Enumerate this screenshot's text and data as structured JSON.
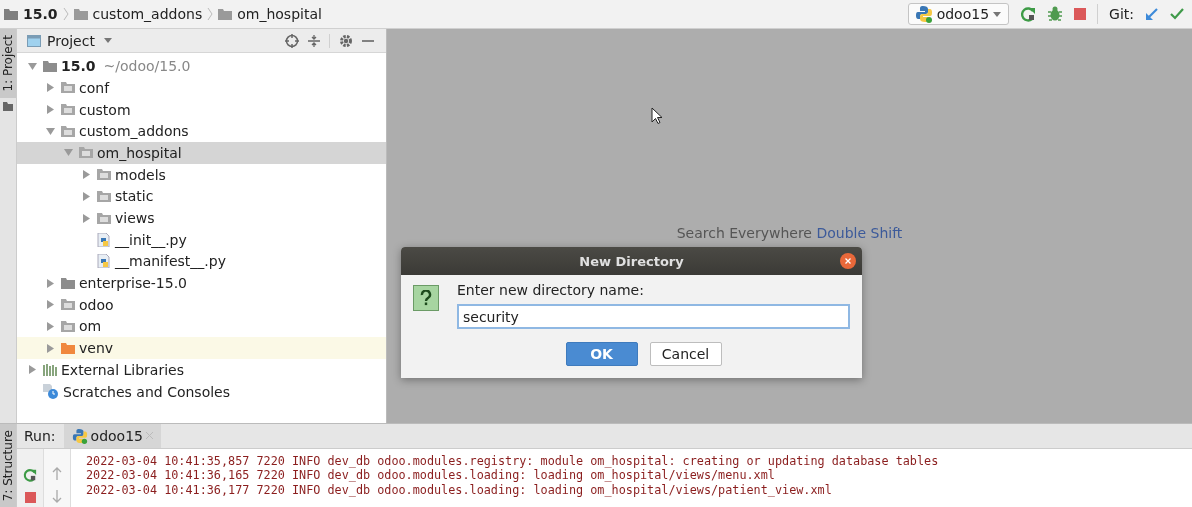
{
  "breadcrumb": [
    {
      "label": "15.0",
      "bold": true
    },
    {
      "label": "custom_addons",
      "bold": false
    },
    {
      "label": "om_hospital",
      "bold": false
    }
  ],
  "toolbar": {
    "run_config": "odoo15",
    "vcs_label": "Git:"
  },
  "left_strip": {
    "tab": "1: Project"
  },
  "project_panel": {
    "title": "Project",
    "tree": [
      {
        "label": "15.0",
        "hint": "~/odoo/15.0",
        "kind": "root-folder",
        "expanded": true,
        "selected": false,
        "children": [
          {
            "label": "conf",
            "kind": "folder",
            "expanded": false,
            "selected": false
          },
          {
            "label": "custom",
            "kind": "folder",
            "expanded": false,
            "selected": false
          },
          {
            "label": "custom_addons",
            "kind": "folder",
            "expanded": true,
            "selected": false,
            "children": [
              {
                "label": "om_hospital",
                "kind": "folder",
                "expanded": true,
                "selected": true,
                "children": [
                  {
                    "label": "models",
                    "kind": "folder",
                    "expanded": false,
                    "selected": false
                  },
                  {
                    "label": "static",
                    "kind": "folder",
                    "expanded": false,
                    "selected": false
                  },
                  {
                    "label": "views",
                    "kind": "folder",
                    "expanded": false,
                    "selected": false
                  },
                  {
                    "label": "__init__.py",
                    "kind": "python-file",
                    "selected": false
                  },
                  {
                    "label": "__manifest__.py",
                    "kind": "python-file",
                    "selected": false
                  }
                ]
              }
            ]
          },
          {
            "label": "enterprise-15.0",
            "kind": "root-folder",
            "expanded": false,
            "selected": false
          },
          {
            "label": "odoo",
            "kind": "folder",
            "expanded": false,
            "selected": false
          },
          {
            "label": "om",
            "kind": "folder",
            "expanded": false,
            "selected": false
          },
          {
            "label": "venv",
            "kind": "excluded-folder",
            "expanded": false,
            "selected": false
          }
        ]
      },
      {
        "label": "External Libraries",
        "kind": "libraries",
        "expanded": false,
        "selected": false
      },
      {
        "label": "Scratches and Consoles",
        "kind": "scratches",
        "selected": false
      }
    ]
  },
  "editor_hint": {
    "text": "Search Everywhere",
    "shortcut": "Double Shift"
  },
  "dialog": {
    "title": "New Directory",
    "prompt": "Enter new directory name:",
    "value": "security",
    "buttons": [
      {
        "label": "OK",
        "default": true
      },
      {
        "label": "Cancel",
        "default": false
      }
    ]
  },
  "run_panel": {
    "label": "Run:",
    "tab": "odoo15",
    "side_tab": "7: Structure",
    "log": [
      "2022-03-04 10:41:35,857 7220 INFO dev_db odoo.modules.registry: module om_hospital: creating or updating database tables",
      "2022-03-04 10:41:36,165 7220 INFO dev_db odoo.modules.loading: loading om_hospital/views/menu.xml",
      "2022-03-04 10:41:36,177 7220 INFO dev_db odoo.modules.loading: loading om_hospital/views/patient_view.xml"
    ]
  }
}
